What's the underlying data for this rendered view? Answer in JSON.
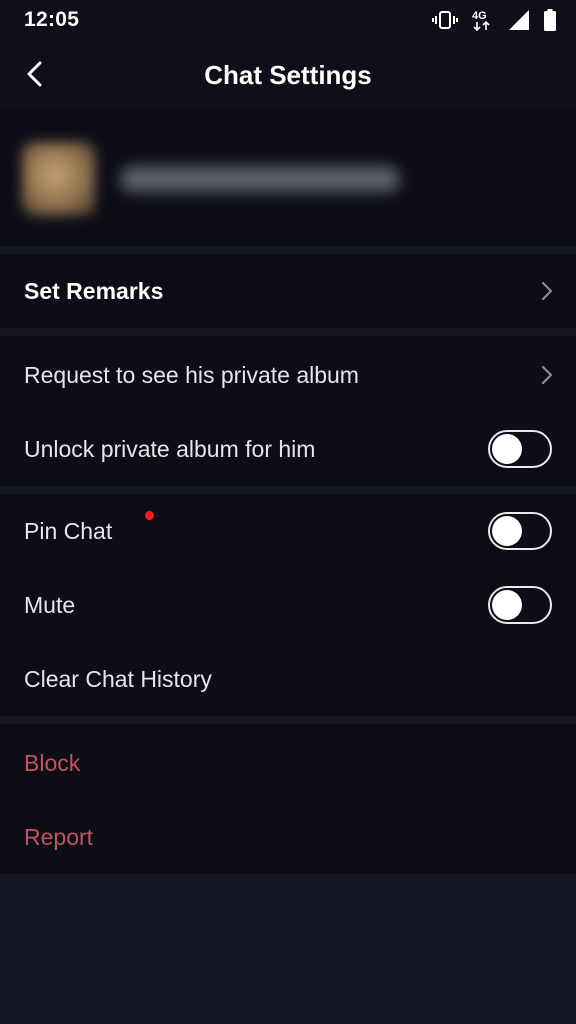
{
  "status_bar": {
    "time": "12:05",
    "network": "4G",
    "icons": [
      "vibrate-icon",
      "network-4g-icon",
      "signal-icon",
      "battery-icon"
    ]
  },
  "header": {
    "title": "Chat Settings",
    "back_icon": "chevron-left-icon"
  },
  "settings": {
    "set_remarks": "Set Remarks",
    "request_album": "Request to see his private album",
    "unlock_album": "Unlock private album for him",
    "pin_chat": "Pin Chat",
    "mute": "Mute",
    "clear_history": "Clear Chat History",
    "block": "Block",
    "report": "Report"
  },
  "toggles": {
    "unlock_album": false,
    "pin_chat": false,
    "mute": false
  },
  "colors": {
    "background": "#141624",
    "section": "#0c0d16",
    "danger_text": "#c0535f",
    "notification_dot": "#ff1a1a"
  }
}
